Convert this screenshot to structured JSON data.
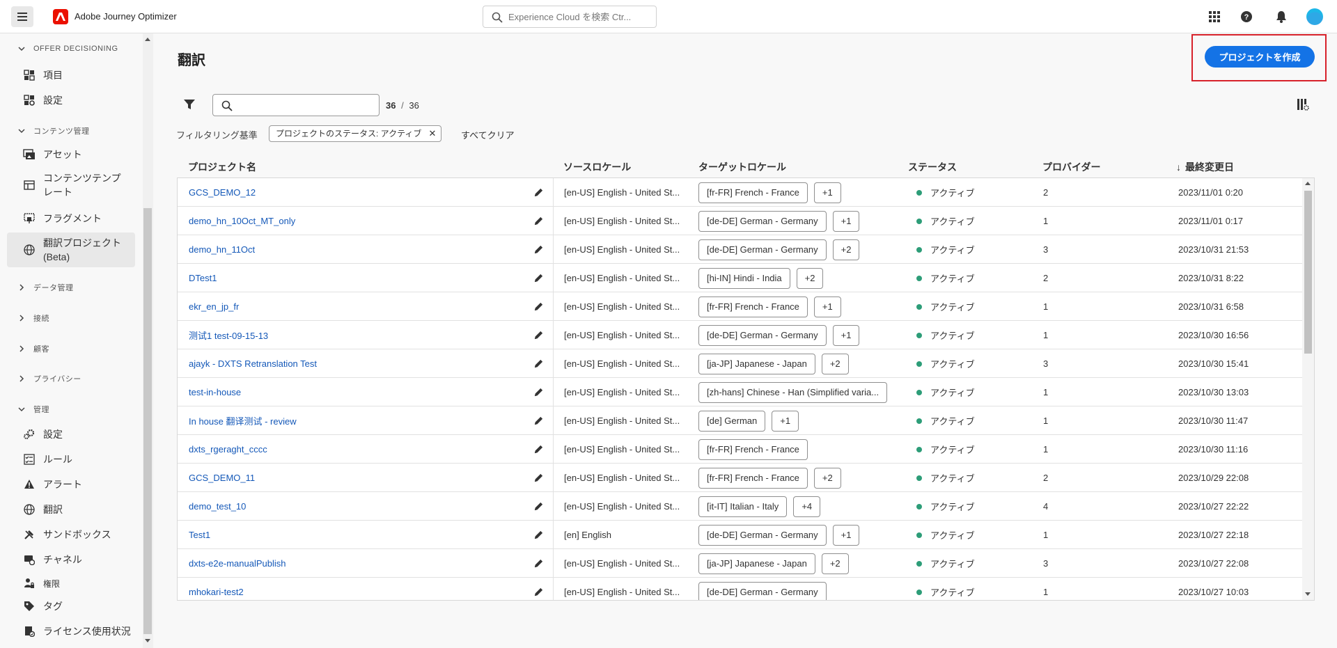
{
  "topbar": {
    "app_title": "Adobe Journey Optimizer",
    "search_placeholder": "Experience Cloud を検索 Ctr..."
  },
  "sidebar": {
    "sections": {
      "offer": "OFFER DECISIONING",
      "content": "コンテンツ管理",
      "data": "データ管理",
      "connect": "接続",
      "customer": "顧客",
      "privacy": "プライバシー",
      "admin": "管理"
    },
    "items": {
      "offer_items": "項目",
      "offer_settings": "設定",
      "assets": "アセット",
      "content_templates": "コンテンツテンプレート",
      "fragments": "フラグメント",
      "translation_projects": "翻訳プロジェクト (Beta)",
      "admin_settings": "設定",
      "rules": "ルール",
      "alerts": "アラート",
      "translation": "翻訳",
      "sandbox": "サンドボックス",
      "channels": "チャネル",
      "permissions": "権限",
      "tags": "タグ",
      "license": "ライセンス使用状況"
    }
  },
  "main": {
    "title": "翻訳",
    "create_button": "プロジェクトを作成",
    "count_shown": "36",
    "count_sep": "/",
    "count_total": "36",
    "filter_label": "フィルタリング基準",
    "filter_tag": "プロジェクトのステータス: アクティブ",
    "filter_tag_close": "✕",
    "clear_all": "すべてクリア"
  },
  "table": {
    "headers": {
      "name": "プロジェクト名",
      "source": "ソースロケール",
      "target": "ターゲットロケール",
      "status": "ステータス",
      "provider": "プロバイダー",
      "modified": "最終変更日"
    },
    "sort_arrow": "↓",
    "rows": [
      {
        "name": "GCS_DEMO_12",
        "source": "[en-US] English - United St...",
        "target": "[fr-FR] French - France",
        "extra": "+1",
        "status": "アクティブ",
        "provider": "2",
        "modified": "2023/11/01 0:20"
      },
      {
        "name": "demo_hn_10Oct_MT_only",
        "source": "[en-US] English - United St...",
        "target": "[de-DE] German - Germany",
        "extra": "+1",
        "status": "アクティブ",
        "provider": "1",
        "modified": "2023/11/01 0:17"
      },
      {
        "name": "demo_hn_11Oct",
        "source": "[en-US] English - United St...",
        "target": "[de-DE] German - Germany",
        "extra": "+2",
        "status": "アクティブ",
        "provider": "3",
        "modified": "2023/10/31 21:53"
      },
      {
        "name": "DTest1",
        "source": "[en-US] English - United St...",
        "target": "[hi-IN] Hindi - India",
        "extra": "+2",
        "status": "アクティブ",
        "provider": "2",
        "modified": "2023/10/31 8:22"
      },
      {
        "name": "ekr_en_jp_fr",
        "source": "[en-US] English - United St...",
        "target": "[fr-FR] French - France",
        "extra": "+1",
        "status": "アクティブ",
        "provider": "1",
        "modified": "2023/10/31 6:58"
      },
      {
        "name": "测试1 test-09-15-13",
        "source": "[en-US] English - United St...",
        "target": "[de-DE] German - Germany",
        "extra": "+1",
        "status": "アクティブ",
        "provider": "1",
        "modified": "2023/10/30 16:56"
      },
      {
        "name": "ajayk - DXTS Retranslation Test",
        "source": "[en-US] English - United St...",
        "target": "[ja-JP] Japanese - Japan",
        "extra": "+2",
        "status": "アクティブ",
        "provider": "3",
        "modified": "2023/10/30 15:41"
      },
      {
        "name": "test-in-house",
        "source": "[en-US] English - United St...",
        "target": "[zh-hans] Chinese - Han (Simplified varia...",
        "extra": "",
        "status": "アクティブ",
        "provider": "1",
        "modified": "2023/10/30 13:03"
      },
      {
        "name": "In house 翻译测试 - review",
        "source": "[en-US] English - United St...",
        "target": "[de] German",
        "extra": "+1",
        "status": "アクティブ",
        "provider": "1",
        "modified": "2023/10/30 11:47"
      },
      {
        "name": "dxts_rgeraght_cccc",
        "source": "[en-US] English - United St...",
        "target": "[fr-FR] French - France",
        "extra": "",
        "status": "アクティブ",
        "provider": "1",
        "modified": "2023/10/30 11:16"
      },
      {
        "name": "GCS_DEMO_11",
        "source": "[en-US] English - United St...",
        "target": "[fr-FR] French - France",
        "extra": "+2",
        "status": "アクティブ",
        "provider": "2",
        "modified": "2023/10/29 22:08"
      },
      {
        "name": "demo_test_10",
        "source": "[en-US] English - United St...",
        "target": "[it-IT] Italian - Italy",
        "extra": "+4",
        "status": "アクティブ",
        "provider": "4",
        "modified": "2023/10/27 22:22"
      },
      {
        "name": "Test1",
        "source": "[en] English",
        "target": "[de-DE] German - Germany",
        "extra": "+1",
        "status": "アクティブ",
        "provider": "1",
        "modified": "2023/10/27 22:18"
      },
      {
        "name": "dxts-e2e-manualPublish",
        "source": "[en-US] English - United St...",
        "target": "[ja-JP] Japanese - Japan",
        "extra": "+2",
        "status": "アクティブ",
        "provider": "3",
        "modified": "2023/10/27 22:08"
      },
      {
        "name": "mhokari-test2",
        "source": "[en-US] English - United St...",
        "target": "[de-DE] German - Germany",
        "extra": "",
        "status": "アクティブ",
        "provider": "1",
        "modified": "2023/10/27 10:03"
      }
    ]
  },
  "colors": {
    "accent": "#1473e6",
    "link": "#1458b8",
    "status_active": "#2d9d78",
    "highlight": "#d7212a"
  }
}
